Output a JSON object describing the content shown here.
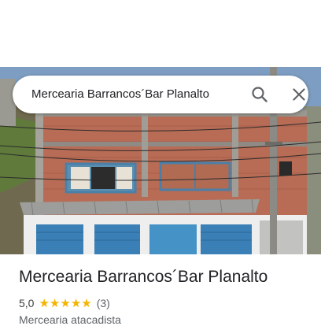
{
  "search": {
    "query": "Mercearia Barrancos´Bar Planalto",
    "search_icon": "search-icon",
    "close_icon": "close-icon"
  },
  "photo": {
    "subject": "storefront-photo"
  },
  "place": {
    "name": "Mercearia Barrancos´Bar Planalto",
    "rating": "5,0",
    "stars": 5,
    "review_count": "(3)",
    "category": "Mercearia atacadista"
  },
  "colors": {
    "star": "#f4b400",
    "title_text": "#202124",
    "secondary_text": "#5f6368",
    "icon": "#5f6368"
  }
}
